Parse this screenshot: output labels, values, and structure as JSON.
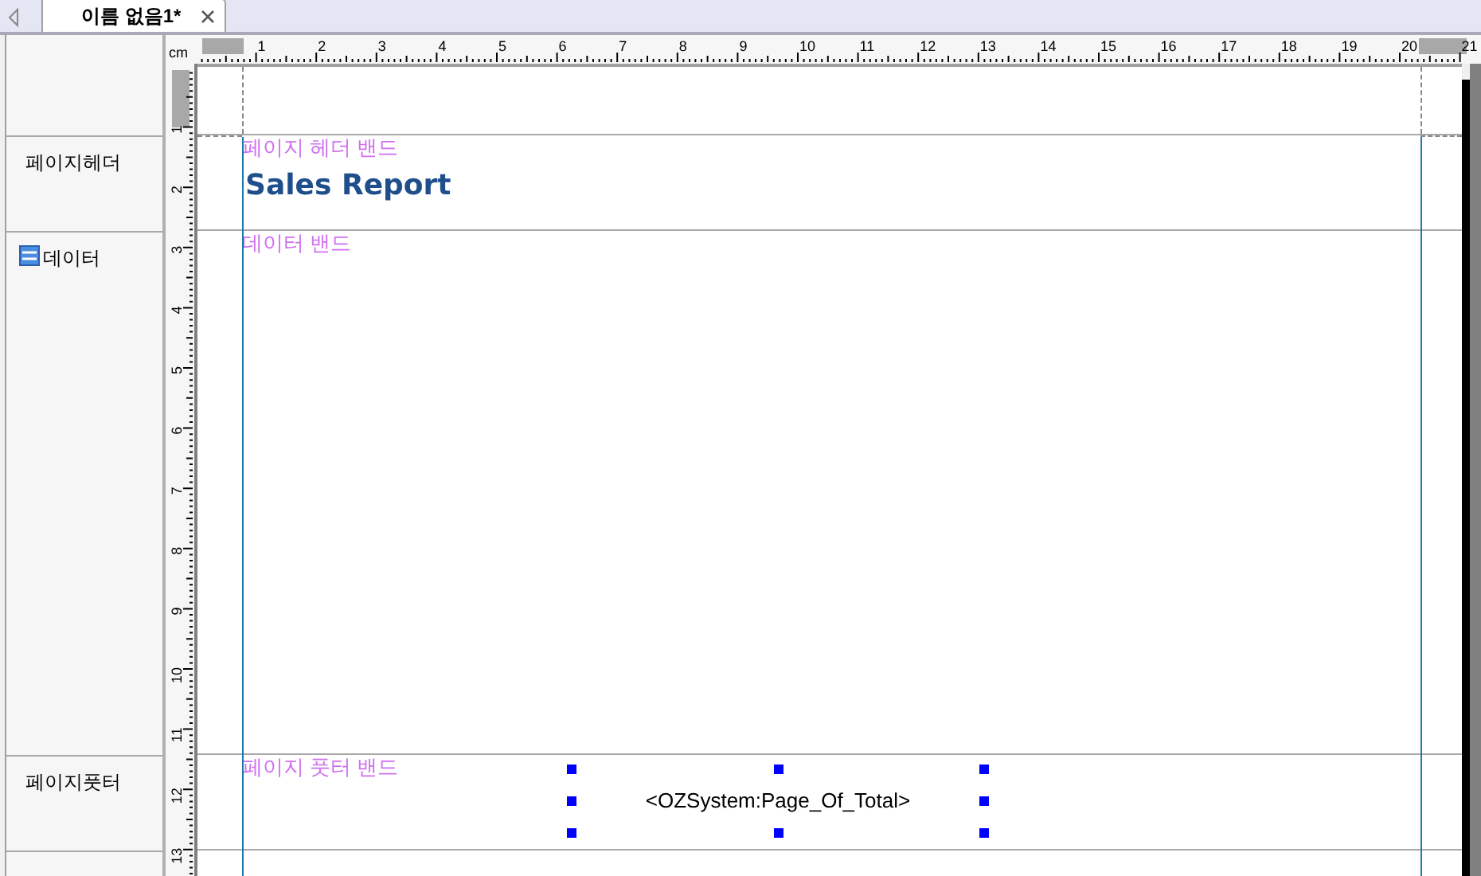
{
  "tab": {
    "title": "이름 없음1*",
    "selected": true
  },
  "ruler": {
    "unit": "cm",
    "horizontal_labels": [
      "1",
      "2",
      "3",
      "4",
      "5",
      "6",
      "7",
      "8",
      "9",
      "10",
      "11",
      "12",
      "13",
      "14",
      "15",
      "16",
      "17",
      "18",
      "19",
      "20",
      "21"
    ],
    "vertical_labels": [
      "1",
      "2",
      "3",
      "4",
      "5",
      "6",
      "7",
      "8",
      "9",
      "10",
      "11",
      "12",
      "13"
    ]
  },
  "bands": [
    {
      "label": "페이지헤더",
      "kind": "header",
      "caption": "페이지 헤더 밴드",
      "items": [
        {
          "kind": "title",
          "text": "Sales Report"
        }
      ]
    },
    {
      "label": "데이터",
      "kind": "data",
      "caption": "데이터 밴드"
    },
    {
      "label": "페이지풋터",
      "kind": "footer",
      "caption": "페이지 풋터 밴드",
      "items": [
        {
          "kind": "field",
          "text": "<OZSystem:Page_Of_Total>",
          "selected": true
        }
      ]
    }
  ]
}
